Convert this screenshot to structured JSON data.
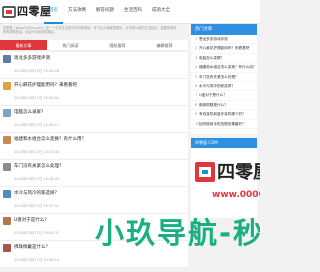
{
  "header": {
    "logo_text": "四零屋",
    "nav": [
      {
        "label": "首页",
        "active": true
      },
      {
        "label": "方法攻略",
        "active": false
      },
      {
        "label": "解答问题",
        "active": false
      },
      {
        "label": "生活百科",
        "active": false
      },
      {
        "label": "成语大全",
        "active": false
      }
    ]
  },
  "notice": "四零屋（www.0000w.com）是一个分享生活常识知识的网站，专门为大家解答疑问，分享有价值的生活知识，如果觉得对你有帮助的话，欢迎分享给你的朋友。",
  "tabs": [
    {
      "label": "最新文章",
      "active": true
    },
    {
      "label": "热门阅读",
      "active": false
    },
    {
      "label": "随机推荐",
      "active": false
    },
    {
      "label": "编辑推荐",
      "active": false
    }
  ],
  "articles": [
    {
      "title": "恩龙多多游戏评测",
      "date": "2024年03月17日 15:40:26"
    },
    {
      "title": "开心麻花护理能用吗？来看看吧",
      "date": "2024年03月17日 15:34:54"
    },
    {
      "title": "电脑怎么录屏？",
      "date": "2024年03月17日 15:28:17"
    },
    {
      "title": "福建和水组合怎么变换？有什么用？",
      "date": "2024年03月17日 15:22:43"
    },
    {
      "title": "车门没有关紧怎么处理？",
      "date": "2024年03月17日 15:16:09"
    },
    {
      "title": "水冷与风冷的家选择？",
      "date": "2024年03月17日 15:10:52"
    },
    {
      "title": "U盘对于是什么？",
      "date": "2024年03月17日 15:04:31"
    },
    {
      "title": "佛珠佩戴是什么？",
      "date": "2024年03月17日 14:58:10"
    }
  ],
  "hot": {
    "heading": "热门文章",
    "items": [
      "恩龙多多游戏评测",
      "开心麻花护理能用吗？来看看吧",
      "电脑怎么录屏？",
      "福建和水组合怎么变换？有什么用？",
      "车门没有关紧怎么处理？",
      "水冷与风冷的家选择？",
      "U盘对于是什么？",
      "佛珠佩戴是什么？",
      "有线耳机和蓝牙耳机哪个好？",
      "如何使用手机拍照效果最好？"
    ]
  },
  "promo": {
    "heading": "四零屋.COM",
    "brand": "四零屋",
    "url": "www.0000w.c"
  },
  "overlay": {
    "text": "小玖导航-秒收"
  },
  "colors": {
    "accent_blue": "#2f8fe0",
    "accent_red": "#e2363f",
    "overlay_green": "#19b07f"
  }
}
